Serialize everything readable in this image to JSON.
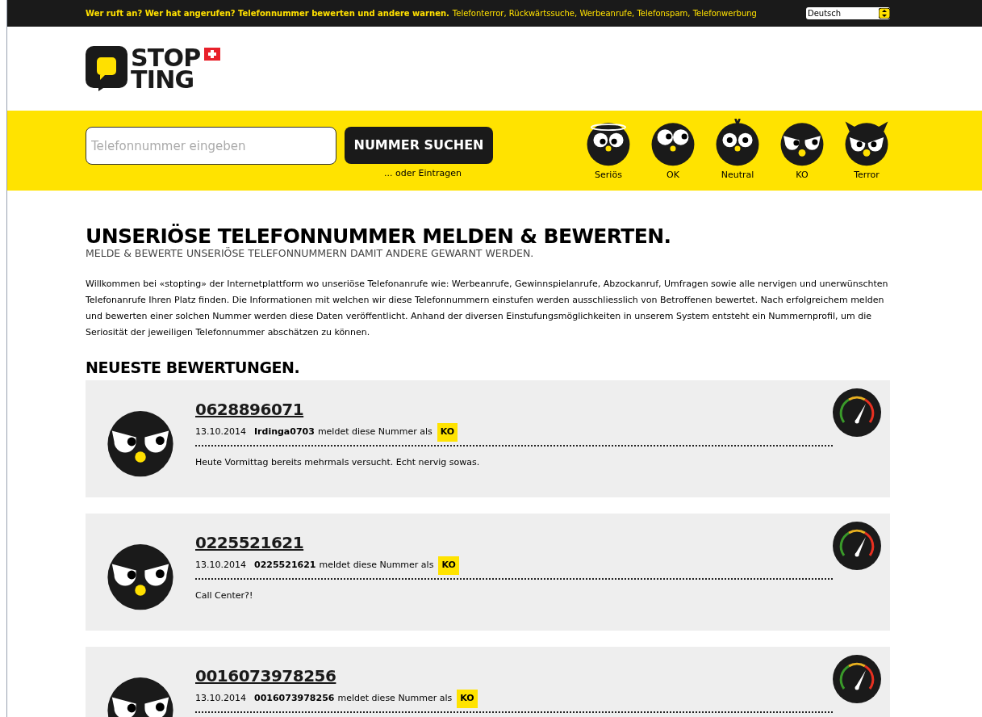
{
  "top_bar": {
    "tagline_bold": "Wer ruft an? Wer hat angerufen? Telefonnummer bewerten und andere warnen.",
    "tagline": "Telefonterror, Rückwärtssuche, Werbeanrufe, Telefonspam, Telefonwerbung",
    "language": "Deutsch"
  },
  "logo": {
    "line_1": "STOP",
    "line_2": "TING"
  },
  "search": {
    "placeholder": "Telefonnummer eingeben",
    "button": "NUMMER SUCHEN",
    "link": "... oder Eintragen"
  },
  "ratings": [
    {
      "kind": "serios",
      "label": "Seriös"
    },
    {
      "kind": "ok",
      "label": "OK"
    },
    {
      "kind": "neutral",
      "label": "Neutral"
    },
    {
      "kind": "ko",
      "label": "KO"
    },
    {
      "kind": "terror",
      "label": "Terror"
    }
  ],
  "intro": {
    "title": "UNSERIÖSE TELEFONNUMMER MELDEN & BEWERTEN.",
    "subtitle": "MELDE & BEWERTE UNSERIÖSE TELEFONNUMMERN DAMIT ANDERE GEWARNT WERDEN.",
    "text": "Willkommen bei «stopting» der Internetplattform wo unseriöse Telefonanrufe wie: Werbeanrufe, Gewinnspielanrufe, Abzockanruf, Umfragen sowie alle nervigen und unerwünschten Telefonanrufe Ihren Platz finden. Die Informationen mit welchen wir diese Telefonnummern einstufen werden ausschliesslich von Betroffenen bewertet. Nach erfolgreichem melden und bewerten einer solchen Nummer werden diese Daten veröffentlicht. Anhand der diversen Einstufungsmöglichkeiten in unserem System entsteht ein Nummernprofil, um die Seriosität der jeweiligen Telefonnummer abschätzen zu können."
  },
  "latest": {
    "title": "NEUESTE BEWERTUNGEN.",
    "entries": [
      {
        "kind": "ko",
        "number": "0628896071",
        "date": "13.10.2014",
        "user": "Irdinga0703",
        "text": "meldet diese Nummer als",
        "rating": "KO",
        "comment": "Heute Vormittag bereits mehrmals versucht. Echt nervig sowas."
      },
      {
        "kind": "ko",
        "number": "0225521621",
        "date": "13.10.2014",
        "user": "0225521621",
        "text": "meldet diese Nummer als",
        "rating": "KO",
        "comment": "Call Center?!"
      },
      {
        "kind": "ko",
        "number": "0016073978256",
        "date": "13.10.2014",
        "user": "0016073978256",
        "text": "meldet diese Nummer als",
        "rating": "KO"
      }
    ]
  }
}
